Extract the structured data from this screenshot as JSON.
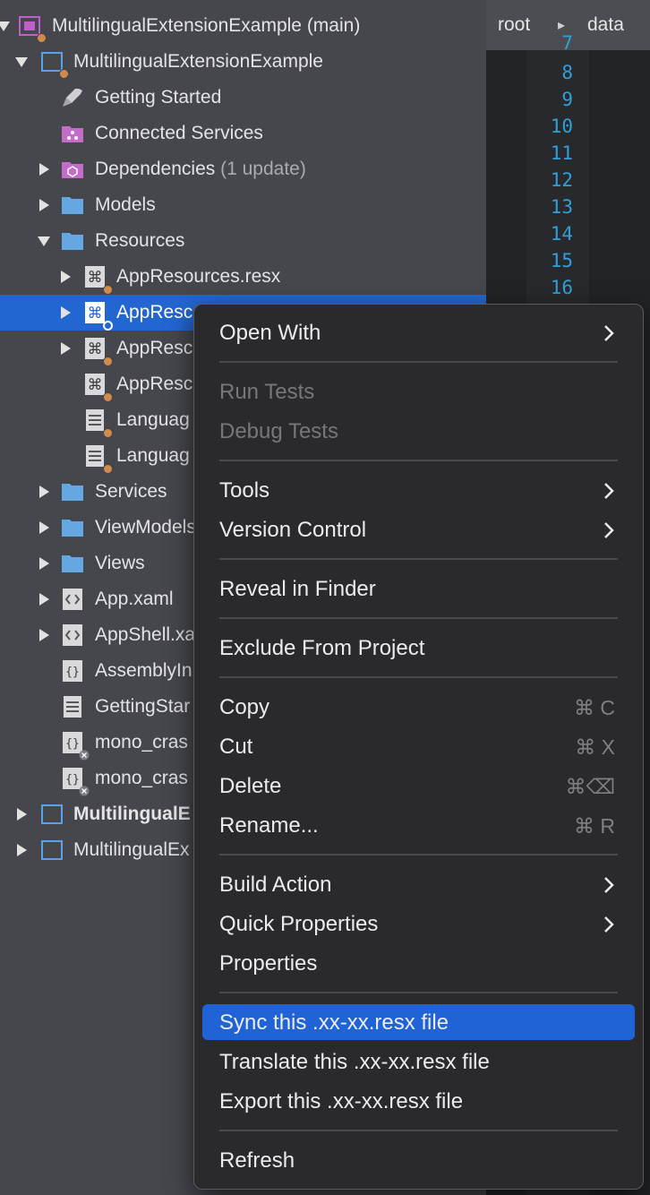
{
  "tree": {
    "rows": [
      {
        "label": "MultilingualExtensionExample (main)",
        "icon": "solution-icon"
      },
      {
        "label": "MultilingualExtensionExample",
        "icon": "project-icon"
      },
      {
        "label": "Getting Started",
        "icon": "rocket-icon"
      },
      {
        "label": "Connected Services",
        "icon": "connected-services-icon"
      },
      {
        "label": "Dependencies",
        "extra": "(1 update)",
        "icon": "package-icon"
      },
      {
        "label": "Models",
        "icon": "folder-icon"
      },
      {
        "label": "Resources",
        "icon": "folder-icon"
      },
      {
        "label": "AppResources.resx",
        "icon": "resx-icon"
      },
      {
        "label": "AppResc",
        "icon": "resx-icon"
      },
      {
        "label": "AppResc",
        "icon": "resx-icon"
      },
      {
        "label": "AppResc",
        "icon": "resx-icon"
      },
      {
        "label": "Languag",
        "icon": "text-file-icon"
      },
      {
        "label": "Languag",
        "icon": "text-file-icon"
      },
      {
        "label": "Services",
        "icon": "folder-icon"
      },
      {
        "label": "ViewModels",
        "icon": "folder-icon"
      },
      {
        "label": "Views",
        "icon": "folder-icon"
      },
      {
        "label": "App.xaml",
        "icon": "xaml-icon"
      },
      {
        "label": "AppShell.xa",
        "icon": "xaml-icon"
      },
      {
        "label": "AssemblyIn",
        "icon": "code-file-icon"
      },
      {
        "label": "GettingStar",
        "icon": "text-file-icon"
      },
      {
        "label": "mono_cras",
        "icon": "code-file-icon"
      },
      {
        "label": "mono_cras",
        "icon": "code-file-icon"
      },
      {
        "label": "MultilingualE",
        "icon": "project-icon"
      },
      {
        "label": "MultilingualEx",
        "icon": "project-icon"
      }
    ]
  },
  "breadcrumb": {
    "root": "root",
    "sep": "▸",
    "data": "data"
  },
  "editor": {
    "line_numbers": [
      "7",
      "8",
      "9",
      "10",
      "11",
      "12",
      "13",
      "14",
      "15",
      "16"
    ]
  },
  "menu": {
    "open_with": "Open With",
    "run_tests": "Run Tests",
    "debug_tests": "Debug Tests",
    "tools": "Tools",
    "version_control": "Version Control",
    "reveal_in_finder": "Reveal in Finder",
    "exclude_from_project": "Exclude From Project",
    "copy": "Copy",
    "copy_shortcut": "⌘ C",
    "cut": "Cut",
    "cut_shortcut": "⌘ X",
    "delete": "Delete",
    "delete_shortcut": "⌘⌫",
    "rename": "Rename...",
    "rename_shortcut": "⌘ R",
    "build_action": "Build Action",
    "quick_properties": "Quick Properties",
    "properties": "Properties",
    "sync": "Sync this .xx-xx.resx file",
    "translate": "Translate this .xx-xx.resx file",
    "export": "Export this .xx-xx.resx file",
    "refresh": "Refresh"
  },
  "colors": {
    "selection": "#2366d1",
    "menu_highlight": "#1f63d6",
    "line_number": "#2fa0d8",
    "badge": "#d08a4c"
  }
}
